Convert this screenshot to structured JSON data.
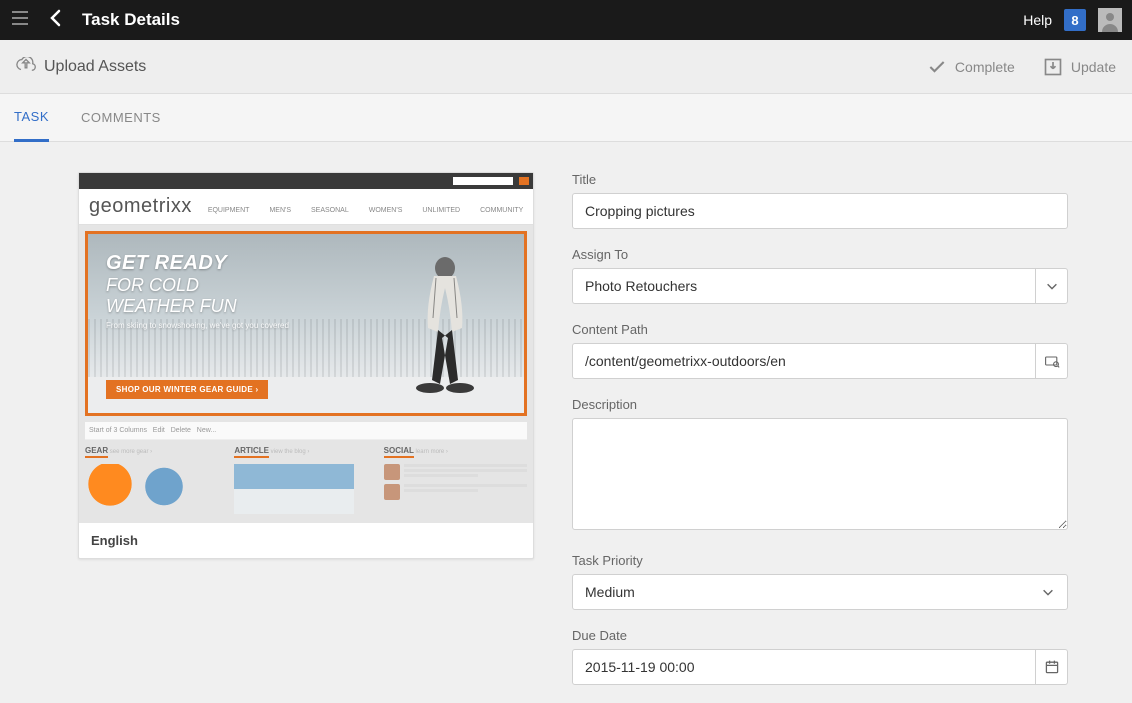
{
  "topbar": {
    "title": "Task Details",
    "help": "Help",
    "badge": "8"
  },
  "actionbar": {
    "upload": "Upload Assets",
    "complete": "Complete",
    "update": "Update"
  },
  "tabs": {
    "task": "TASK",
    "comments": "COMMENTS"
  },
  "preview": {
    "caption": "English",
    "logo": "geometrixx",
    "nav": [
      "EQUIPMENT",
      "MEN'S",
      "SEASONAL",
      "WOMEN'S",
      "UNLIMITED",
      "COMMUNITY"
    ],
    "hero_l1": "GET READY",
    "hero_l2": "FOR COLD",
    "hero_l3": "WEATHER FUN",
    "hero_l4": "From skiing to snowshoeing, we've got you covered",
    "hero_cta": "SHOP OUR WINTER GEAR GUIDE ›",
    "col1": "GEAR",
    "col2": "ARTICLE",
    "col3": "SOCIAL"
  },
  "form": {
    "title_label": "Title",
    "title_value": "Cropping pictures",
    "assign_label": "Assign To",
    "assign_value": "Photo Retouchers",
    "path_label": "Content Path",
    "path_value": "/content/geometrixx-outdoors/en",
    "desc_label": "Description",
    "desc_value": "",
    "priority_label": "Task Priority",
    "priority_value": "Medium",
    "due_label": "Due Date",
    "due_value": "2015-11-19 00:00"
  }
}
